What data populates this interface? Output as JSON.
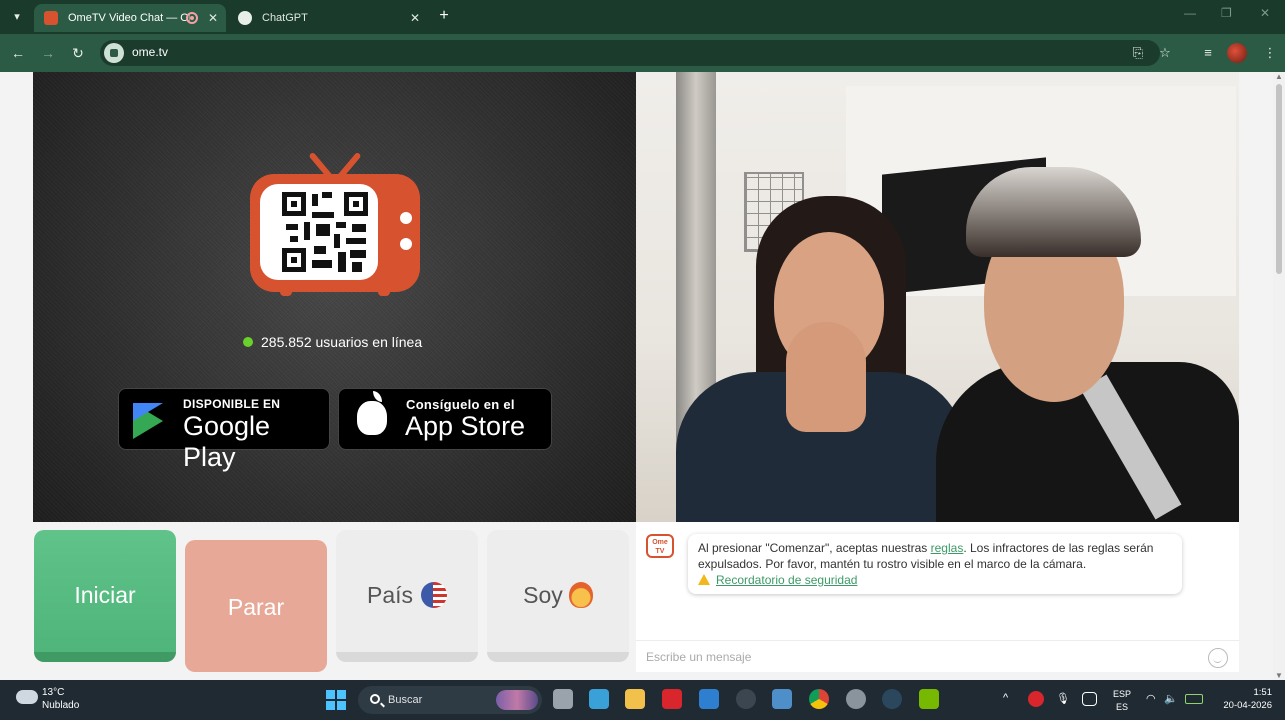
{
  "browser": {
    "tabs": [
      {
        "title": "OmeTV Video Chat — Ome",
        "active": true,
        "recording": true
      },
      {
        "title": "ChatGPT",
        "active": false
      }
    ],
    "url": "ome.tv"
  },
  "left_panel": {
    "online_count": "285.852 usuarios en línea",
    "google_play": {
      "small": "DISPONIBLE EN",
      "big": "Google Play"
    },
    "app_store": {
      "small": "Consíguelo en el",
      "big": "App Store"
    }
  },
  "controls": {
    "start": "Iniciar",
    "stop": "Parar",
    "country": "País",
    "gender": "Soy"
  },
  "chat": {
    "logo_text": "Ome TV",
    "notice_prefix": "Al presionar \"Comenzar\", aceptas nuestras ",
    "notice_link": "reglas",
    "notice_suffix": ". Los infractores de las reglas serán expulsados. Por favor, mantén tu rostro visible en el marco de la cámara.",
    "safety_link": "Recordatorio de seguridad",
    "input_placeholder": "Escribe un mensaje"
  },
  "taskbar": {
    "temperature": "13°C",
    "weather": "Nublado",
    "search": "Buscar",
    "language": "ESP",
    "layout": "ES",
    "time": "1:51",
    "date": "20-04-2026"
  },
  "colors": {
    "browser_frame": "#1a3a2c",
    "toolbar": "#2b5a45",
    "start_button": "#5dbe85",
    "stop_button": "#e8a898",
    "ometv_orange": "#d7532f",
    "online_dot": "#6ad12b",
    "link_green": "#3c9a66"
  },
  "icons": [
    "tab-search-icon",
    "ometv-favicon",
    "chatgpt-favicon",
    "recording-icon",
    "close-icon",
    "new-tab-icon",
    "back-icon",
    "forward-icon",
    "reload-icon",
    "site-info-icon",
    "install-icon",
    "star-icon",
    "media-icon",
    "profile-avatar",
    "qr-tv-logo",
    "google-play-icon",
    "apple-icon",
    "us-flag-icon",
    "person-emoji-icon",
    "warning-icon",
    "emoji-icon",
    "weather-icon",
    "windows-start-icon",
    "search-icon"
  ]
}
